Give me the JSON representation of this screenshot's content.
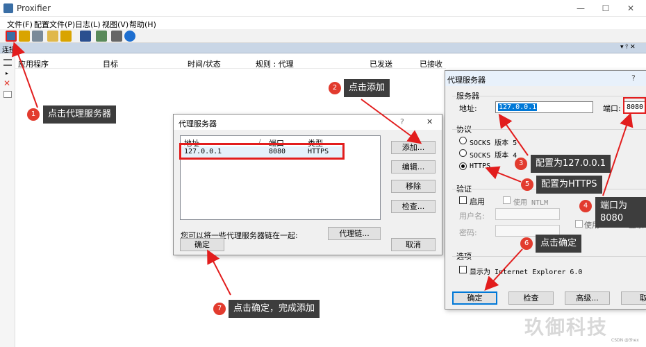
{
  "app": {
    "title": "Proxifier"
  },
  "window_controls": {
    "minimize": "—",
    "maximize": "☐",
    "close": "✕"
  },
  "menu": [
    "文件(F)",
    "配置文件(P)",
    "日志(L)",
    "视图(V)",
    "帮助(H)"
  ],
  "panel": {
    "title": "连接",
    "controls": "▾ ⫯ ✕"
  },
  "columns": [
    "应用程序",
    "目标",
    "时间/状态",
    "规则 : 代理",
    "已发送",
    "已接收"
  ],
  "proxy_list_dialog": {
    "title": "代理服务器",
    "help": "?",
    "close": "✕",
    "headers": [
      "地址",
      "/",
      "端口",
      "类型"
    ],
    "rows": [
      {
        "address": "127.0.0.1",
        "port": "8080",
        "type": "HTTPS"
      }
    ],
    "buttons": {
      "add": "添加...",
      "edit": "编辑...",
      "remove": "移除",
      "check": "检查..."
    },
    "chain_text": "您可以将一些代理服务器链在一起:",
    "chain_button": "代理链...",
    "ok": "确定",
    "cancel": "取消"
  },
  "proxy_edit_dialog": {
    "title": "代理服务器",
    "help": "?",
    "server_group": "服务器",
    "address_label": "地址:",
    "address_value": "127.0.0.1",
    "port_label": "端口:",
    "port_value": "8080",
    "protocol_group": "协议",
    "protocols": [
      "SOCKS 版本 5",
      "SOCKS 版本 4",
      "HTTPS"
    ],
    "selected_protocol": "HTTPS",
    "auth_group": "验证",
    "enable_label": "启用",
    "ntlm_label": "使用 NTLM",
    "username_label": "用户名:",
    "password_label": "密码:",
    "use_partial": "使用",
    "login_partial": "登录",
    "options_group": "选项",
    "show_ie_label": "显示为 Internet Explorer 6.0",
    "ok": "确定",
    "check": "检查",
    "advanced": "高级...",
    "cancel_partial": "取"
  },
  "callouts": [
    {
      "num": "1",
      "text": "点击代理服务器"
    },
    {
      "num": "2",
      "text": "点击添加"
    },
    {
      "num": "3",
      "text": "配置为127.0.0.1"
    },
    {
      "num": "4",
      "text": "端口为8080"
    },
    {
      "num": "5",
      "text": "配置为HTTPS"
    },
    {
      "num": "6",
      "text": "点击确定"
    },
    {
      "num": "7",
      "text": "点击确定，完成添加"
    }
  ],
  "watermark": "玖御科技",
  "credit": "CSDN @3hex",
  "colors": {
    "callout_bg": "#3d3d3d",
    "badge": "#e23b2e",
    "arrow": "#e21d1d",
    "selection": "#0078d7"
  }
}
